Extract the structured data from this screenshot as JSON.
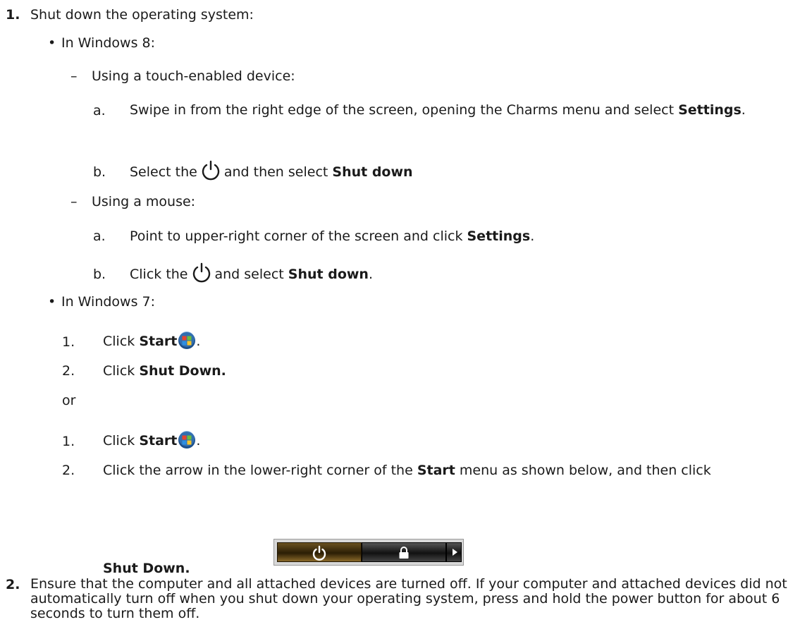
{
  "step1": {
    "number": "1.",
    "text": "Shut down the operating system:",
    "win8": {
      "bullet": "•",
      "label": "In Windows 8:",
      "touch": {
        "dash": "–",
        "label": "Using a touch-enabled device:",
        "a_marker": "a.",
        "a_text": "Swipe in from the right edge of the screen, opening the Charms menu and select ",
        "a_bold": "Settings",
        "a_end": ".",
        "b_marker": "b.",
        "b_pre": "Select the",
        "b_post": "and then select ",
        "b_bold": "Shut down"
      },
      "mouse": {
        "dash": "–",
        "label": "Using a mouse:",
        "a_marker": "a.",
        "a_text": "Point to upper-right corner of the screen and click ",
        "a_bold": "Settings",
        "a_end": ".",
        "b_marker": "b.",
        "b_pre": "Click the",
        "b_post": "and select ",
        "b_bold": "Shut down",
        "b_end": "."
      }
    },
    "win7": {
      "bullet": "•",
      "label": "In Windows 7:",
      "m1": "1.",
      "click": "Click ",
      "start": "Start",
      "period": ".",
      "m2": "2.",
      "shut_down": "Shut Down.",
      "or": "or",
      "m1b": "1.",
      "m2b": "2.",
      "arrow_text": "Click the arrow in the lower-right corner of the ",
      "arrow_start": "Start",
      "arrow_end": " menu as shown below, and then click",
      "shut_down_final": "Shut Down."
    }
  },
  "step2": {
    "number": "2.",
    "text": "Ensure that the computer and all attached devices are turned off. If your computer and attached devices did not automatically turn off when you shut down your operating system, press and hold the power button for about 6 seconds to turn them off."
  },
  "icons": {
    "power": "power-icon",
    "windows_logo": "windows-start-orb-icon",
    "lock": "lock-icon",
    "arrow": "arrow-right-icon"
  }
}
